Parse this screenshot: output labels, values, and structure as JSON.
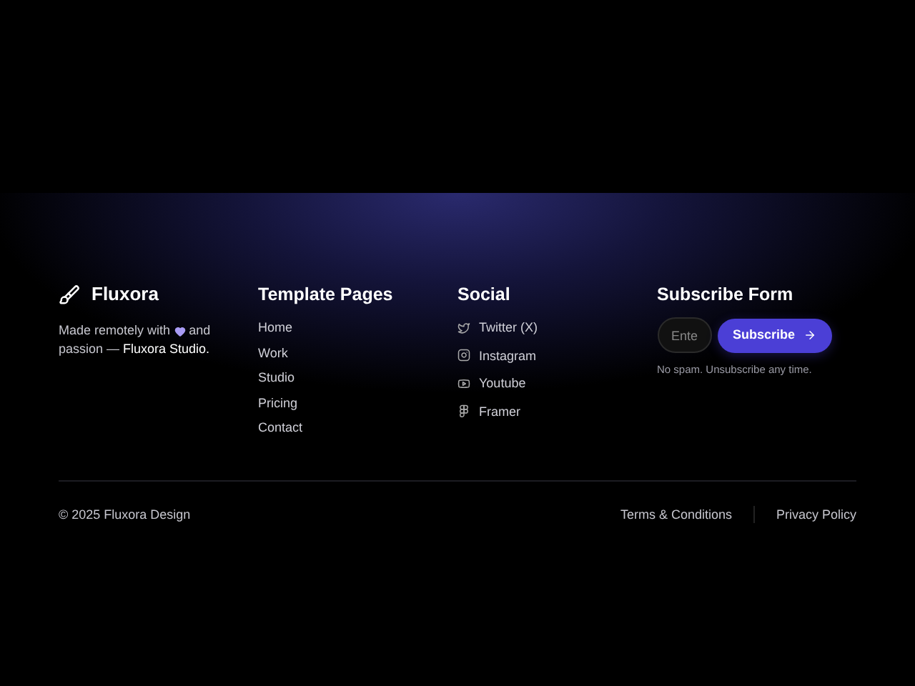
{
  "brand": {
    "name": "Fluxora",
    "tagline_before": "Made remotely with",
    "tagline_mid": "and",
    "tagline_after": "passion — **Fluxora Studio.**"
  },
  "columns": [
    {
      "title": "Template Pages",
      "kind": "links",
      "items": [
        {
          "label": "Home"
        },
        {
          "label": "Work"
        },
        {
          "label": "Studio"
        },
        {
          "label": "Pricing"
        },
        {
          "label": "Contact"
        }
      ]
    },
    {
      "title": "Social",
      "kind": "social",
      "items": [
        {
          "label": "Twitter (X)"
        },
        {
          "label": "Instagram"
        },
        {
          "label": "Youtube"
        },
        {
          "label": "Framer"
        }
      ]
    }
  ],
  "subscribe": {
    "title": "Subscribe Form",
    "placeholder": "Ente",
    "button": "Subscribe",
    "note": "No spam. Unsubscribe any time."
  },
  "bottom": {
    "copyright": "© 2025 Fluxora Design",
    "links": [
      "Terms & Conditions",
      "Privacy Policy"
    ]
  }
}
